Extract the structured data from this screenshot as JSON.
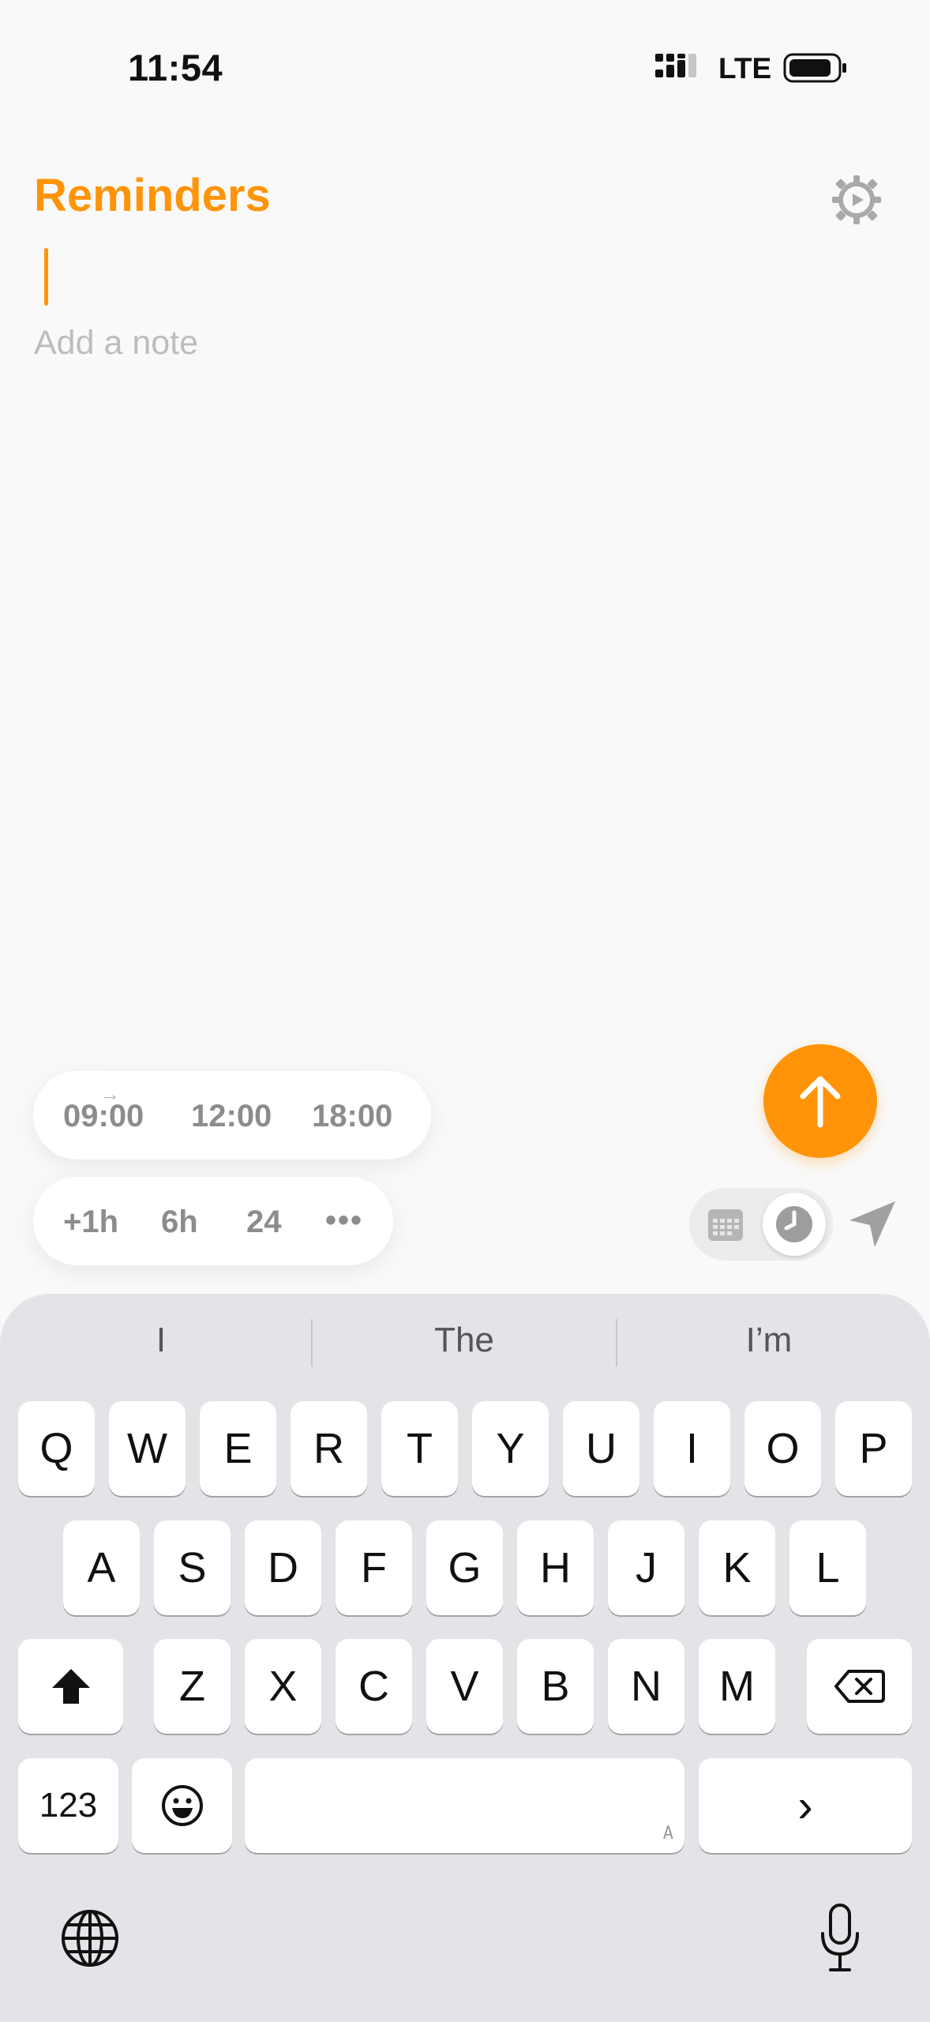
{
  "status": {
    "time": "11:54",
    "network": "LTE"
  },
  "header": {
    "title": "Reminders"
  },
  "editor": {
    "note_placeholder": "Add a note"
  },
  "quick_times": [
    "09:00",
    "12:00",
    "18:00"
  ],
  "quick_durations": [
    "+1h",
    "6h",
    "24",
    "•••"
  ],
  "keyboard": {
    "suggestions": [
      "I",
      "The",
      "I’m"
    ],
    "row1": [
      "Q",
      "W",
      "E",
      "R",
      "T",
      "Y",
      "U",
      "I",
      "O",
      "P"
    ],
    "row2": [
      "A",
      "S",
      "D",
      "F",
      "G",
      "H",
      "J",
      "K",
      "L"
    ],
    "row3": [
      "Z",
      "X",
      "C",
      "V",
      "B",
      "N",
      "M"
    ],
    "numbers_key": "123",
    "return_key": "›",
    "space_hint": "A"
  },
  "colors": {
    "accent": "#ff9409",
    "background": "#f9f9f9",
    "keyboard": "#e3e3e8"
  },
  "icons": [
    "signal-icon",
    "battery-icon",
    "gear-icon",
    "send-arrow-icon",
    "calendar-icon",
    "clock-icon",
    "location-arrow-icon",
    "shift-icon",
    "delete-icon",
    "emoji-icon",
    "globe-icon",
    "microphone-icon"
  ]
}
